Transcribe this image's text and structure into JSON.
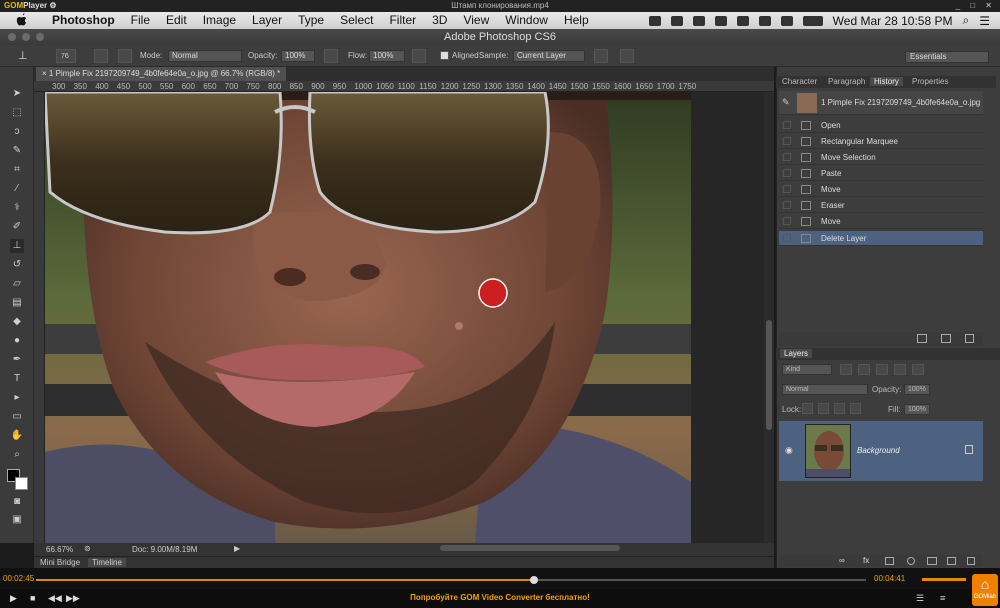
{
  "gom": {
    "logo_a": "GOM",
    "logo_b": "Player",
    "logo_gear": "⚙",
    "file_name": "Штамп клонирования.mp4",
    "window_buttons": "_ □ ✕",
    "time_elapsed": "00:02:45",
    "time_total": "00:04:41",
    "progress": 0.6,
    "volume": 0.9,
    "promo": "Попробуйте GOM Video Converter бесплатно!",
    "app_logo_label": "GOMlab"
  },
  "menubar": {
    "app": "Photoshop",
    "menus": [
      "File",
      "Edit",
      "Image",
      "Layer",
      "Type",
      "Select",
      "Filter",
      "3D",
      "View",
      "Window",
      "Help"
    ],
    "clock": "Wed Mar 28  10:58 PM",
    "search_glyph": "⌕",
    "list_glyph": "☰"
  },
  "ps": {
    "title": "Adobe Photoshop CS6",
    "options": {
      "brush_size": "76",
      "mode_label": "Mode:",
      "mode_value": "Normal",
      "opacity_label": "Opacity:",
      "opacity_value": "100%",
      "flow_label": "Flow:",
      "flow_value": "100%",
      "aligned_label": "Aligned",
      "sample_label": "Sample:",
      "sample_value": "Current Layer",
      "workspace": "Essentials"
    },
    "document_tab": "1 Pimple Fix 2197209749_4b0fe64e0a_o.jpg @ 66.7% (RGB/8) *",
    "ruler_ticks": [
      "300",
      "350",
      "400",
      "450",
      "500",
      "550",
      "600",
      "650",
      "700",
      "750",
      "800",
      "850",
      "900",
      "950",
      "1000",
      "1050",
      "1100",
      "1150",
      "1200",
      "1250",
      "1300",
      "1350",
      "1400",
      "1450",
      "1500",
      "1550",
      "1600",
      "1650",
      "1700",
      "1750"
    ],
    "status": {
      "zoom": "66.67%",
      "doc": "Doc: 9.00M/8.19M"
    },
    "bottom_tabs": [
      "Mini Bridge",
      "Timeline"
    ],
    "panel_tabs": [
      "Character",
      "Paragraph",
      "History",
      "Properties"
    ],
    "history": {
      "snapshot": "1 Pimple Fix 2197209749_4b0fe64e0a_o.jpg",
      "items": [
        "Open",
        "Rectangular Marquee",
        "Move Selection",
        "Paste",
        "Move",
        "Eraser",
        "Move",
        "Delete Layer"
      ]
    },
    "layers": {
      "tab": "Layers",
      "kind": "Kind",
      "blend": "Normal",
      "opacity_label": "Opacity:",
      "opacity_value": "100%",
      "lock_label": "Lock:",
      "fill_label": "Fill:",
      "fill_value": "100%",
      "layer_name": "Background"
    }
  }
}
